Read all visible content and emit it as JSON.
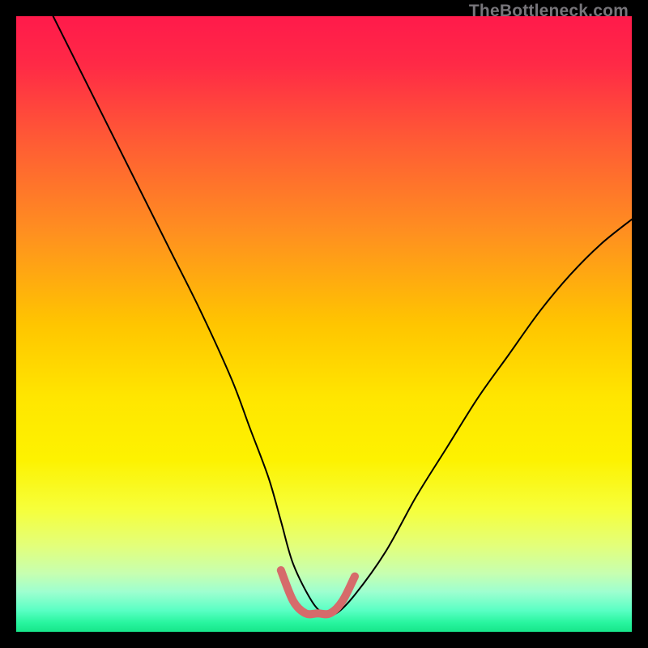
{
  "watermark": {
    "text": "TheBottleneck.com"
  },
  "gradient": {
    "stops": [
      {
        "offset": 0.0,
        "color": "#ff1a4b"
      },
      {
        "offset": 0.08,
        "color": "#ff2a46"
      },
      {
        "offset": 0.2,
        "color": "#ff5a35"
      },
      {
        "offset": 0.35,
        "color": "#ff8f20"
      },
      {
        "offset": 0.5,
        "color": "#ffc500"
      },
      {
        "offset": 0.62,
        "color": "#ffe600"
      },
      {
        "offset": 0.72,
        "color": "#fdf200"
      },
      {
        "offset": 0.8,
        "color": "#f6ff3a"
      },
      {
        "offset": 0.86,
        "color": "#e3ff7a"
      },
      {
        "offset": 0.905,
        "color": "#c7ffb0"
      },
      {
        "offset": 0.935,
        "color": "#9effd0"
      },
      {
        "offset": 0.965,
        "color": "#5affc4"
      },
      {
        "offset": 0.985,
        "color": "#28f59f"
      },
      {
        "offset": 1.0,
        "color": "#17e68a"
      }
    ]
  },
  "chart_data": {
    "type": "line",
    "title": "",
    "xlabel": "",
    "ylabel": "",
    "xlim": [
      0,
      100
    ],
    "ylim": [
      0,
      100
    ],
    "series": [
      {
        "name": "bottleneck-curve",
        "stroke": "#000000",
        "stroke_width": 2,
        "x": [
          6,
          10,
          15,
          20,
          25,
          30,
          35,
          38,
          41,
          43,
          45,
          48,
          50,
          52,
          55,
          60,
          65,
          70,
          75,
          80,
          85,
          90,
          95,
          100
        ],
        "y": [
          100,
          92,
          82,
          72,
          62,
          52,
          41,
          33,
          25,
          18,
          11,
          5,
          3,
          3,
          6,
          13,
          22,
          30,
          38,
          45,
          52,
          58,
          63,
          67
        ]
      },
      {
        "name": "sweet-spot-band",
        "stroke": "#d66b6b",
        "stroke_width": 10,
        "x": [
          43,
          45,
          47,
          49,
          51,
          53,
          55
        ],
        "y": [
          10,
          5,
          3,
          3,
          3,
          5,
          9
        ]
      }
    ],
    "annotations": [
      {
        "text": "TheBottleneck.com",
        "pos": "top-right"
      }
    ]
  }
}
